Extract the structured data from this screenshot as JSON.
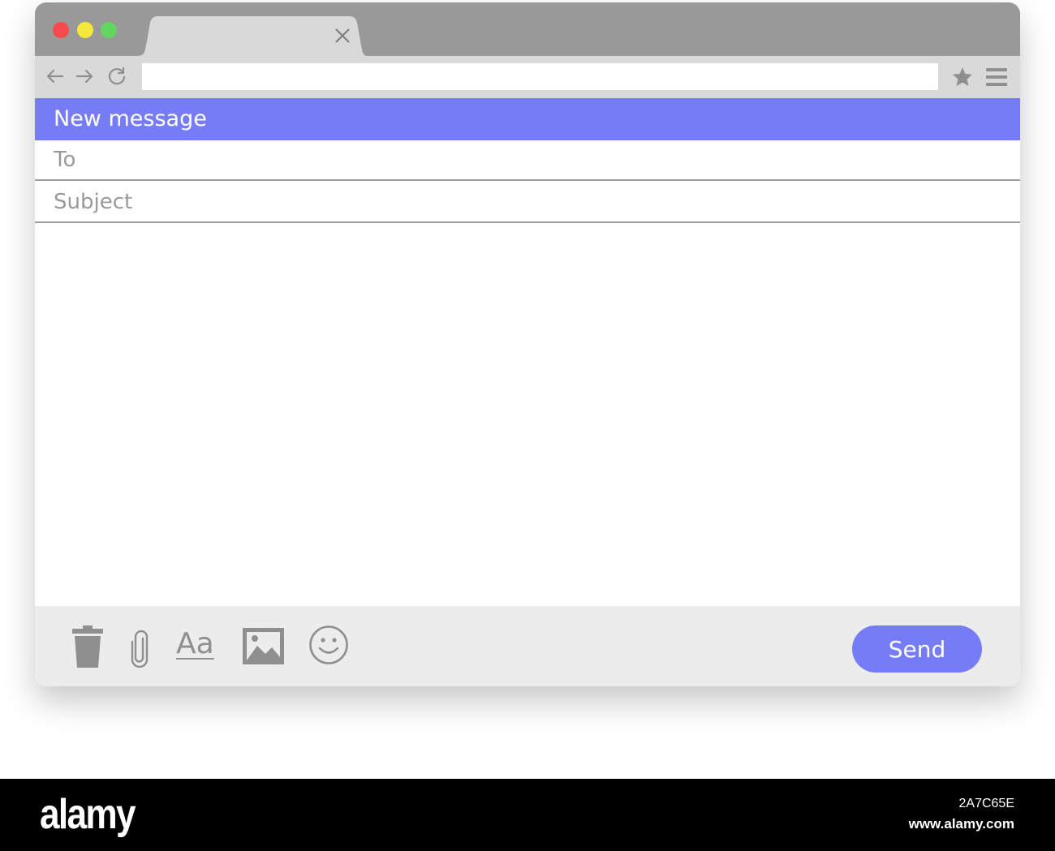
{
  "browser": {
    "address_value": "",
    "icons": {
      "back": "back-arrow-icon",
      "forward": "forward-arrow-icon",
      "reload": "reload-icon",
      "bookmark": "star-icon",
      "menu": "hamburger-menu-icon",
      "tab_close": "close-icon"
    }
  },
  "compose": {
    "header_title": "New message",
    "to_placeholder": "To",
    "subject_placeholder": "Subject",
    "body_value": "",
    "footer": {
      "font_label": "Aa",
      "send_label": "Send",
      "icons": [
        "trash-icon",
        "paperclip-icon",
        "font-format-icon",
        "image-icon",
        "emoji-icon"
      ]
    }
  },
  "watermark": {
    "logo": "alamy",
    "image_id": "2A7C65E",
    "url": "www.alamy.com"
  },
  "colors": {
    "accent": "#767cf5",
    "titlebar": "#999999",
    "toolbar": "#d9d9d9",
    "footer": "#ececec",
    "icon_gray": "#8f8f8f"
  }
}
